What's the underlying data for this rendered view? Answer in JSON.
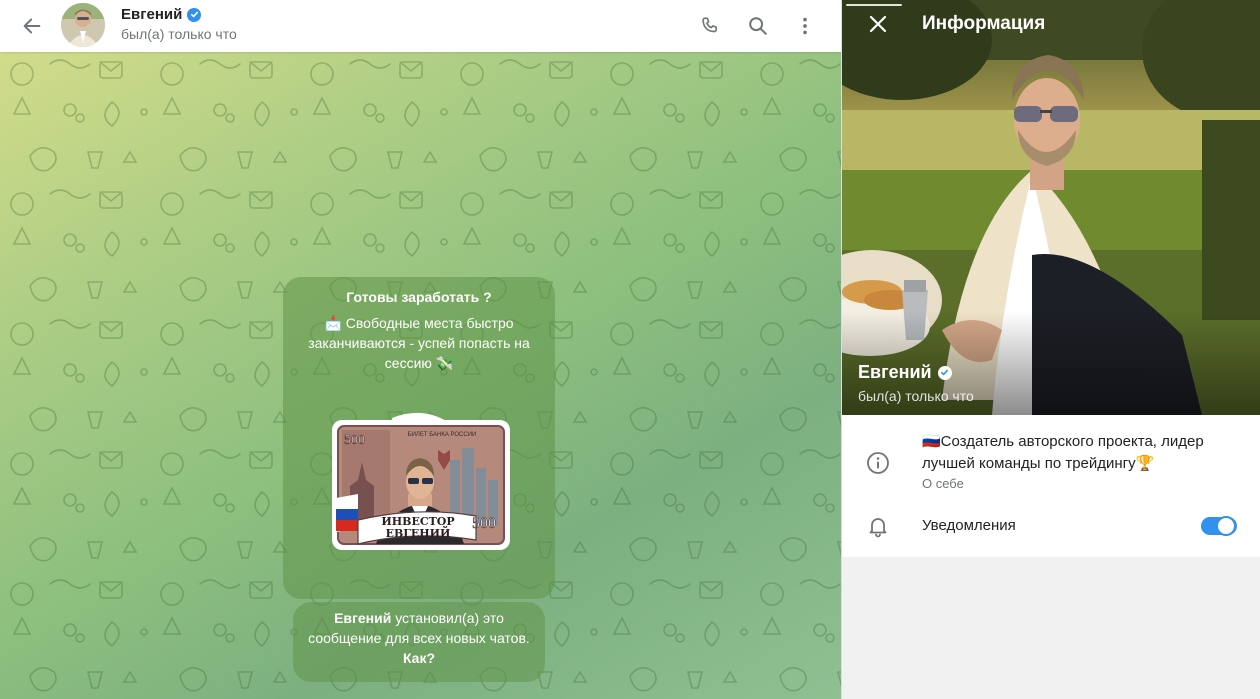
{
  "chat": {
    "header": {
      "name": "Евгений",
      "status": "был(а) только что",
      "icons": [
        "back-arrow-icon",
        "phone-icon",
        "search-icon",
        "more-vertical-icon"
      ]
    },
    "pinned_message": {
      "title": "Готовы заработать ?",
      "text": "📩 Свободные места быстро заканчиваются - успей попасть на сессию 💸",
      "sticker": {
        "header": "БИЛЕТ БАНКА РОССИИ",
        "denomination": "500",
        "banner_line1": "ИНВЕСТОР",
        "banner_line2": "ЕВГЕНИЙ"
      }
    },
    "service_message": {
      "name": "Евгений",
      "text": " установил(а) это сообщение для всех новых чатов.",
      "link": "Как?"
    }
  },
  "info_panel": {
    "title": "Информация",
    "name": "Евгений",
    "status": "был(а) только что",
    "bio": "🇷🇺Создатель авторского проекта, лидер лучшей команды по трейдингу🏆",
    "bio_label": "О себе",
    "notifications_label": "Уведомления",
    "notifications_on": true,
    "icons": [
      "close-icon",
      "info-icon",
      "bell-icon",
      "verified-icon"
    ]
  },
  "colors": {
    "accent": "#3390ec",
    "bubble": "rgba(96,148,72,0.55)",
    "text_secondary": "#707579"
  }
}
